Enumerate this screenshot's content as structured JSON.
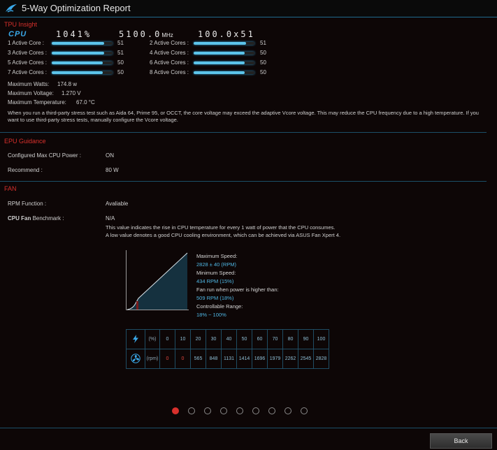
{
  "window": {
    "title": "5-Way Optimization Report"
  },
  "tpu": {
    "section_title": "TPU Insight",
    "cpu_badge": "CPU",
    "ratio_readout": "1041%",
    "freq_readout": "5100.0",
    "freq_unit": "MHz",
    "bclk_readout": "100.0x51",
    "cores": [
      {
        "label": "1 Active Core :",
        "value": "51",
        "fill": 0.86
      },
      {
        "label": "2 Active Cores :",
        "value": "51",
        "fill": 0.86
      },
      {
        "label": "3 Active Cores :",
        "value": "51",
        "fill": 0.86
      },
      {
        "label": "4 Active Cores :",
        "value": "50",
        "fill": 0.84
      },
      {
        "label": "5 Active Cores :",
        "value": "50",
        "fill": 0.84
      },
      {
        "label": "6 Active Cores :",
        "value": "50",
        "fill": 0.84
      },
      {
        "label": "7 Active Cores :",
        "value": "50",
        "fill": 0.84
      },
      {
        "label": "8 Active Cores :",
        "value": "50",
        "fill": 0.84
      }
    ],
    "max_watts_label": "Maximum Watts:",
    "max_watts": "174.8 w",
    "max_voltage_label": "Maximum Voltage:",
    "max_voltage": "1.270 V",
    "max_temp_label": "Maximum Temperature:",
    "max_temp": "67.0 °C",
    "note": "When you run a third-party stress test such as Aida 64, Prime 95, or OCCT, the core voltage may exceed the adaptive Vcore voltage. This may reduce the CPU frequency due to a high temperature. If you want to use third-party stress tests, manually configure the Vcore voltage."
  },
  "epu": {
    "section_title": "EPU Guidance",
    "configured_label": "Configured Max CPU Power :",
    "configured_value": "ON",
    "recommend_label": "Recommend :",
    "recommend_value": "80 W"
  },
  "fan": {
    "section_title": "FAN",
    "rpm_function_label": "RPM Function :",
    "rpm_function_value": "Avaliable",
    "benchmark_label_bold": "CPU Fan",
    "benchmark_label_rest": " Benchmark :",
    "benchmark_value": "N/A",
    "benchmark_note_1": "This value indicates the rise in CPU temperature for every 1 watt of power that the CPU consumes.",
    "benchmark_note_2": "A low value denotes a good CPU cooling environment, which can be achieved via ASUS Fan Xpert 4.",
    "legend": {
      "max_speed_label": "Maximum Speed:",
      "max_speed_value": "2828 ± 40 (RPM)",
      "min_speed_label": "Minimum Speed:",
      "min_speed_value": "434 RPM (15%)",
      "run_label": "Fan run when power is higher than:",
      "run_value": "509 RPM (18%)",
      "range_label": "Controllable Range:",
      "range_value": "18% ~ 100%"
    },
    "table": {
      "power_unit": "(%)",
      "rpm_unit": "(rpm)",
      "power_values": [
        "0",
        "10",
        "20",
        "30",
        "40",
        "50",
        "60",
        "70",
        "80",
        "90",
        "100"
      ],
      "rpm_values": [
        "0",
        "0",
        "565",
        "848",
        "1131",
        "1414",
        "1696",
        "1979",
        "2262",
        "2545",
        "2828"
      ]
    }
  },
  "pagination": {
    "count": 9,
    "active": 0
  },
  "footer": {
    "back_label": "Back"
  },
  "colors": {
    "accent": "#4fb6e3",
    "section_title": "#d8302c",
    "bar_fill": "#5cc4ea"
  }
}
